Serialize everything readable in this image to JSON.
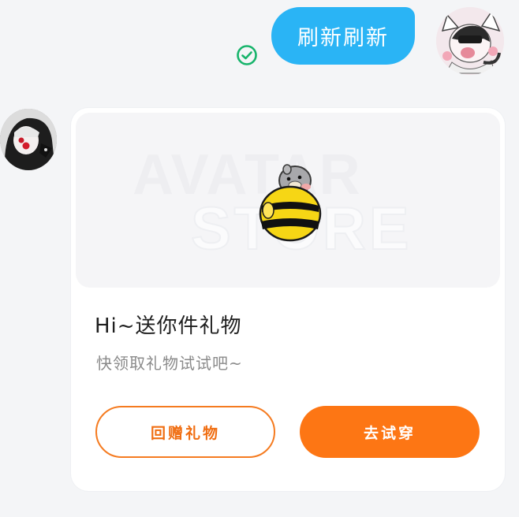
{
  "conversation": {
    "sent_message": {
      "text": "刷新刷新",
      "status_icon": "check-circle-icon",
      "bubble_color": "#2ab4f5"
    },
    "received_card": {
      "banner_watermark_line1": "AVATAR",
      "banner_watermark_line2": "STORE",
      "gift_icon": "bee-plush-gift",
      "title": "Hi~送你件礼物",
      "subtitle": "快领取礼物试试吧~",
      "buttons": {
        "return_gift": "回赠礼物",
        "try_on": "去试穿"
      }
    }
  },
  "colors": {
    "accent_orange": "#fd7614",
    "delivered_green": "#17b46b",
    "background": "#f4f5f7"
  }
}
